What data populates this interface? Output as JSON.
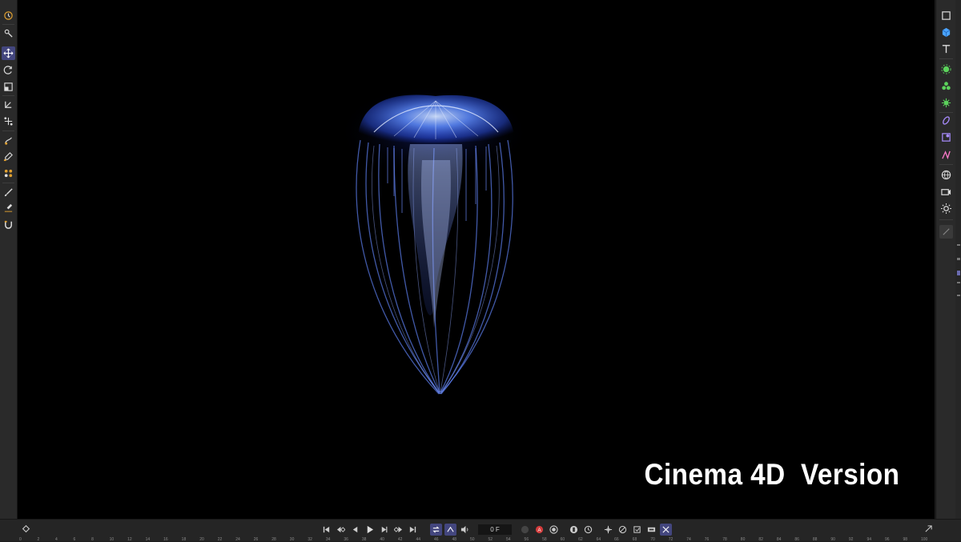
{
  "viewport": {
    "watermark_text": "Cinema 4D  Version",
    "background": "#000000",
    "subject_description_icon": "jellyfish-render"
  },
  "left_toolbar": {
    "tools": [
      {
        "icon": "render-view-icon"
      },
      {
        "icon": "live-selection-icon"
      },
      {
        "icon": "move-tool-icon",
        "active": true
      },
      {
        "icon": "rotate-tool-icon"
      },
      {
        "icon": "scale-tool-icon"
      },
      {
        "icon": "transform-icon"
      },
      {
        "icon": "axis-tool-icon"
      },
      {
        "icon": "sculpt-pull-icon"
      },
      {
        "icon": "paint-icon"
      },
      {
        "icon": "mograph-icon"
      },
      {
        "icon": "brush-icon"
      },
      {
        "icon": "knife-icon"
      },
      {
        "icon": "magnet-icon"
      }
    ]
  },
  "right_toolbar": {
    "tools": [
      {
        "icon": "cube-outline-icon"
      },
      {
        "icon": "cube-icon"
      },
      {
        "icon": "text-tool-icon"
      },
      {
        "icon": "generator-icon"
      },
      {
        "icon": "cloner-icon"
      },
      {
        "icon": "effector-icon"
      },
      {
        "icon": "deformer-icon"
      },
      {
        "icon": "field-icon"
      },
      {
        "icon": "spline-icon"
      },
      {
        "icon": "scene-icon"
      },
      {
        "icon": "camera-icon"
      },
      {
        "icon": "light-icon"
      },
      {
        "icon": "material-icon"
      }
    ]
  },
  "timeline": {
    "frame_value": "0 F",
    "ticks": [
      "0",
      "2",
      "4",
      "6",
      "8",
      "10",
      "12",
      "14",
      "16",
      "18",
      "20",
      "22",
      "24",
      "26",
      "28",
      "30",
      "32",
      "34",
      "36",
      "38",
      "40",
      "42",
      "44",
      "46",
      "48",
      "50",
      "52",
      "54",
      "56",
      "58",
      "60",
      "62",
      "64",
      "66",
      "68",
      "70",
      "72",
      "74",
      "76",
      "78",
      "80",
      "82",
      "84",
      "86",
      "88",
      "90",
      "92",
      "94",
      "96",
      "98",
      "100"
    ],
    "accent": "#43467e",
    "record_color": "#d33b3b"
  }
}
